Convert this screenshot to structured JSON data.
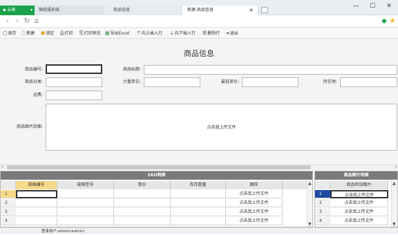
{
  "titlebar": {
    "app_tab": "云表",
    "tabs": [
      "微商城系统",
      "商品信息",
      "新建:商品信息"
    ],
    "close_glyph": "×",
    "minimize_glyph": "—",
    "maximize_glyph": "☐",
    "window_close_glyph": "✕"
  },
  "nav": {
    "back": "‹",
    "forward": "›",
    "refresh": "↻",
    "home": "⌂"
  },
  "toolbar": {
    "items": [
      {
        "icon": "save-icon",
        "label": "保存"
      },
      {
        "icon": "new-icon",
        "label": "新建"
      },
      {
        "icon": "lock-icon",
        "label": "锁定"
      },
      {
        "icon": "print-icon",
        "label": "打印"
      },
      {
        "icon": "print-preview-icon",
        "label": "打印预览"
      },
      {
        "icon": "excel-icon",
        "label": "导出Excel"
      },
      {
        "icon": "insert-up-icon",
        "label": "向上插入行"
      },
      {
        "icon": "insert-down-icon",
        "label": "向下插入行"
      },
      {
        "icon": "delete-row-icon",
        "label": "删除行"
      },
      {
        "icon": "exit-icon",
        "label": "退出"
      }
    ]
  },
  "form": {
    "title": "商品信息",
    "labels": {
      "product_no": "商品编号:",
      "product_title": "商品标题:",
      "category": "商品分类:",
      "unit": "计量单位:",
      "min_price": "最低单价:",
      "location": "所在地:",
      "shipping": "运费:",
      "cover": "商品图片封面:"
    },
    "values": {
      "product_no": "",
      "product_title": "",
      "category": "",
      "unit": "",
      "min_price": "",
      "location": "",
      "shipping": ""
    },
    "cover_upload": "点击我上传文件"
  },
  "sku": {
    "title": "SKU明细",
    "columns": [
      "规格编号",
      "规格型号",
      "单价",
      "库存数量",
      "图样"
    ],
    "rows": [
      {
        "n": "1",
        "cells": [
          "",
          "",
          "",
          "",
          "点击我上传文件"
        ]
      },
      {
        "n": "2",
        "cells": [
          "",
          "",
          "",
          "",
          "点击我上传文件"
        ]
      },
      {
        "n": "3",
        "cells": [
          "",
          "",
          "",
          "",
          "点击我上传文件"
        ]
      },
      {
        "n": "4",
        "cells": [
          "",
          "",
          "",
          "",
          "点击我上传文件"
        ]
      }
    ]
  },
  "images": {
    "title": "商品图片明细",
    "column": "商品附加图片",
    "rows": [
      {
        "n": "1",
        "cell": "点击我上传文件"
      },
      {
        "n": "2",
        "cell": "点击我上传文件"
      },
      {
        "n": "3",
        "cell": "点击我上传文件"
      },
      {
        "n": "4",
        "cell": "点击我上传文件"
      }
    ]
  },
  "status": {
    "user": "登录用户:admin(admin)"
  },
  "colors": {
    "accent_green": "#1aa34a",
    "selected_header": "#f6d98a",
    "selected_row": "#1f4aa2",
    "panel_title": "#7a7a7a"
  }
}
